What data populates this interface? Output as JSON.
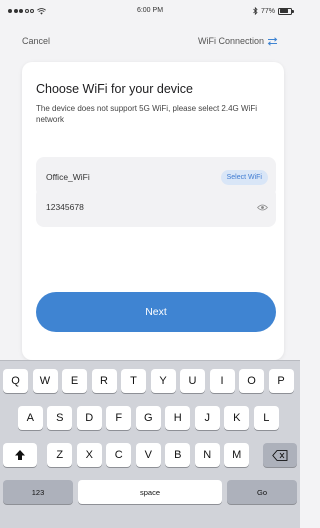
{
  "status_bar": {
    "time": "6:00 PM",
    "battery_text": "77%",
    "battery_level": 0.77
  },
  "nav": {
    "cancel_label": "Cancel",
    "wifi_connection_label": "WiFi Connection",
    "swap_icon": "swap-arrows-icon"
  },
  "card": {
    "title": "Choose WiFi for your device",
    "description": "The device does not support 5G WiFi, please select 2.4G WiFi network",
    "ssid_value": "Office_WiFi",
    "select_wifi_label": "Select WiFi",
    "password_value": "12345678",
    "eye_icon": "eye-icon",
    "next_label": "Next"
  },
  "keyboard": {
    "row1": [
      "Q",
      "W",
      "E",
      "R",
      "T",
      "Y",
      "U",
      "I",
      "O",
      "P"
    ],
    "row2": [
      "A",
      "S",
      "D",
      "F",
      "G",
      "H",
      "J",
      "K",
      "L"
    ],
    "row3": [
      "Z",
      "X",
      "C",
      "V",
      "B",
      "N",
      "M"
    ],
    "shift_icon": "shift-icon",
    "delete_icon": "delete-icon",
    "numbers_label": "123",
    "space_label": "space",
    "go_label": "Go"
  },
  "colors": {
    "accent": "#3f84d2",
    "select_wifi_bg": "#d9e6f7",
    "background": "#f3f3f5",
    "keyboard_bg": "#d1d3d9"
  }
}
